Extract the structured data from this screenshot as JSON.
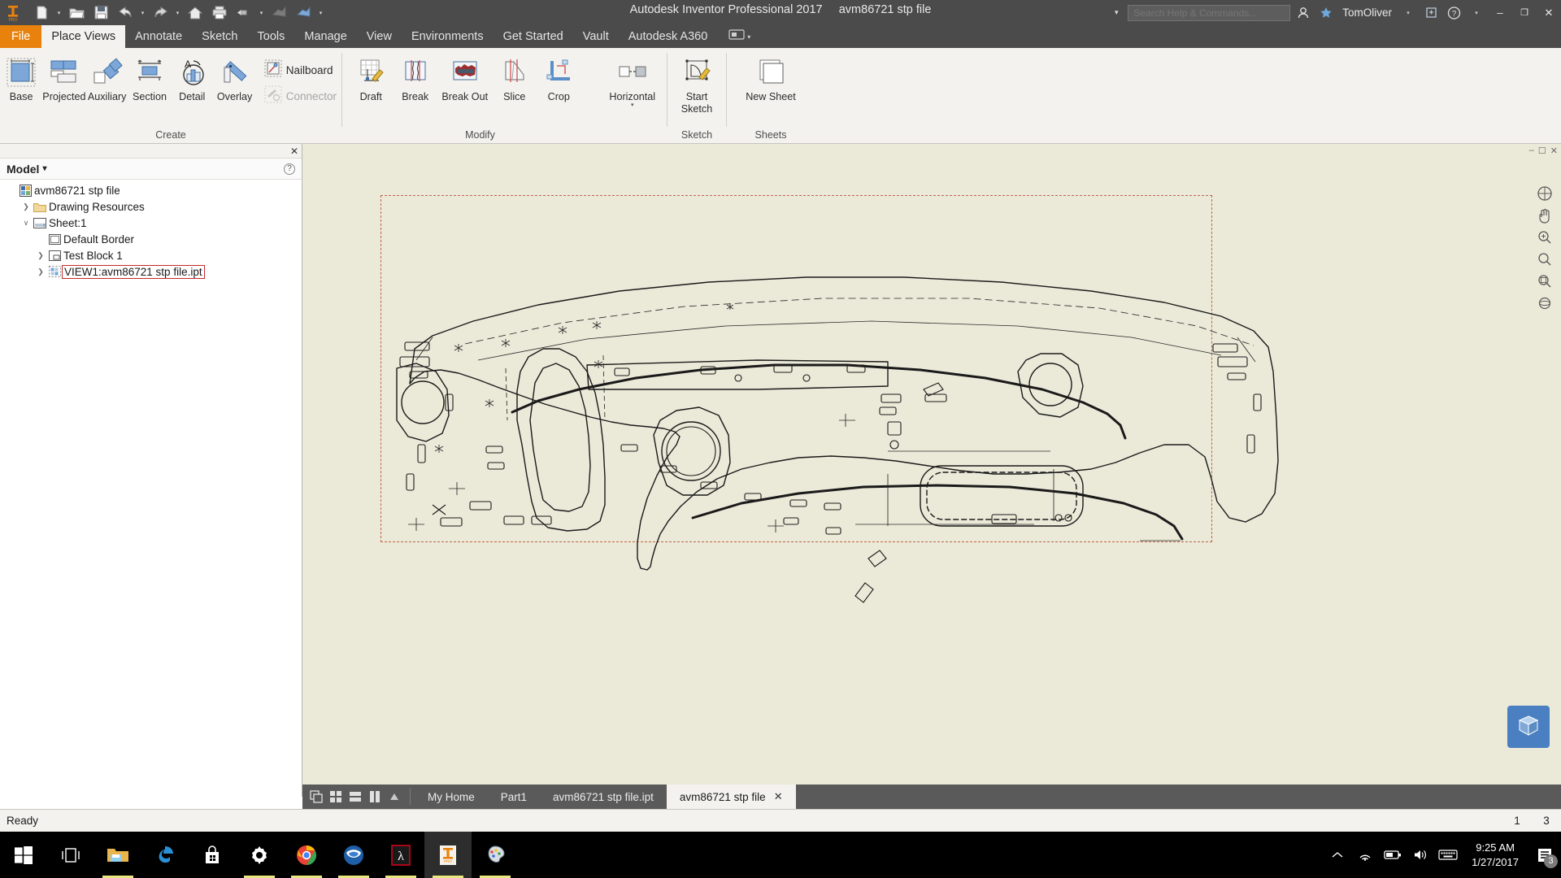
{
  "app": {
    "title": "Autodesk Inventor Professional 2017",
    "document_title": "avm86721 stp file",
    "user": "TomOliver",
    "accent_orange": "#e8820c",
    "titlebar_bg": "#4b4b4b",
    "ribbon_bg": "#f3f2ee",
    "canvas_bg": "#ebe9d8"
  },
  "quick_access": {
    "items": [
      {
        "name": "new-file",
        "icon": "new-document-icon",
        "has_caret": true
      },
      {
        "name": "open-file",
        "icon": "open-folder-icon",
        "has_caret": false
      },
      {
        "name": "save-file",
        "icon": "floppy-save-icon",
        "has_caret": false
      },
      {
        "name": "undo",
        "icon": "undo-arrow-icon",
        "has_caret": true
      },
      {
        "name": "redo",
        "icon": "redo-arrow-icon",
        "has_caret": true
      },
      {
        "name": "home",
        "icon": "home-icon",
        "has_caret": false
      },
      {
        "name": "print",
        "icon": "printer-icon",
        "has_caret": false
      },
      {
        "name": "return",
        "icon": "return-icon",
        "has_caret": true
      },
      {
        "name": "update-1",
        "icon": "update-grey-icon",
        "has_caret": false
      },
      {
        "name": "update-2",
        "icon": "update-blue-icon",
        "has_caret": true
      }
    ]
  },
  "search": {
    "placeholder": "Search Help & Commands..."
  },
  "title_right": {
    "signin_icon": "signin-icon",
    "star_icon": "star-icon",
    "user_caret": "▾",
    "exchange_icon": "autodesk-exchange-icon",
    "help_icon": "help-question-icon",
    "help_caret": "▾",
    "minimize": "–",
    "maximize": "❐",
    "close": "✕"
  },
  "ribbon_tabs": [
    {
      "label": "File",
      "state": "file"
    },
    {
      "label": "Place Views",
      "state": "active"
    },
    {
      "label": "Annotate",
      "state": "normal"
    },
    {
      "label": "Sketch",
      "state": "normal"
    },
    {
      "label": "Tools",
      "state": "normal"
    },
    {
      "label": "Manage",
      "state": "normal"
    },
    {
      "label": "View",
      "state": "normal"
    },
    {
      "label": "Environments",
      "state": "normal"
    },
    {
      "label": "Get Started",
      "state": "normal"
    },
    {
      "label": "Vault",
      "state": "normal"
    },
    {
      "label": "Autodesk A360",
      "state": "normal"
    }
  ],
  "ribbon_panels": [
    {
      "name": "create",
      "label": "Create",
      "big_buttons": [
        {
          "label": "Base",
          "icon": "base-view-icon"
        },
        {
          "label": "Projected",
          "icon": "projected-view-icon"
        },
        {
          "label": "Auxiliary",
          "icon": "auxiliary-view-icon"
        },
        {
          "label": "Section",
          "icon": "section-view-icon"
        },
        {
          "label": "Detail",
          "icon": "detail-view-icon"
        },
        {
          "label": "Overlay",
          "icon": "overlay-view-icon"
        }
      ],
      "small_buttons": [
        {
          "label": "Nailboard",
          "icon": "nailboard-icon",
          "disabled": false
        },
        {
          "label": "Connector",
          "icon": "connector-icon",
          "disabled": true
        }
      ]
    },
    {
      "name": "modify",
      "label": "Modify",
      "big_buttons": [
        {
          "label": "Draft",
          "icon": "draft-icon"
        },
        {
          "label": "Break",
          "icon": "break-icon"
        },
        {
          "label": "Break Out",
          "icon": "break-out-icon"
        },
        {
          "label": "Slice",
          "icon": "slice-icon"
        },
        {
          "label": "Crop",
          "icon": "crop-icon"
        },
        {
          "label": "Horizontal",
          "icon": "horizontal-align-icon",
          "has_caret": true
        }
      ],
      "small_buttons": []
    },
    {
      "name": "sketch",
      "label": "Sketch",
      "big_buttons": [
        {
          "label": "Start Sketch",
          "icon": "start-sketch-icon"
        }
      ],
      "small_buttons": []
    },
    {
      "name": "sheets",
      "label": "Sheets",
      "big_buttons": [
        {
          "label": "New Sheet",
          "icon": "new-sheet-icon"
        }
      ],
      "small_buttons": []
    }
  ],
  "browser": {
    "title": "Model",
    "title_caret": "▾",
    "close_glyph": "✕",
    "help_glyph": "?",
    "tree": [
      {
        "label": "avm86721 stp file",
        "depth": 0,
        "expander": "",
        "icon": "drawing-doc-icon",
        "selected": false
      },
      {
        "label": "Drawing Resources",
        "depth": 1,
        "expander": "❯",
        "icon": "folder-icon",
        "selected": false
      },
      {
        "label": "Sheet:1",
        "depth": 1,
        "expander": "❯",
        "expanded": true,
        "icon": "sheet-icon",
        "selected": false
      },
      {
        "label": "Default Border",
        "depth": 2,
        "expander": "",
        "icon": "border-icon",
        "selected": false
      },
      {
        "label": "Test Block 1",
        "depth": 2,
        "expander": "❯",
        "icon": "title-block-icon",
        "selected": false
      },
      {
        "label": "VIEW1:avm86721 stp file.ipt",
        "depth": 2,
        "expander": "❯",
        "icon": "view-icon",
        "selected": true
      }
    ]
  },
  "canvas": {
    "window_controls": [
      "–",
      "❐",
      "✕"
    ],
    "nav_tools": [
      {
        "name": "full-navigation-wheel",
        "icon": "nav-wheel-icon"
      },
      {
        "name": "pan-tool",
        "icon": "hand-pan-icon"
      },
      {
        "name": "zoom-tool",
        "icon": "magnifier-zoom-icon"
      },
      {
        "name": "zoom-window",
        "icon": "zoom-window-icon"
      },
      {
        "name": "zoom-all",
        "icon": "zoom-all-icon"
      },
      {
        "name": "orbit-tool",
        "icon": "orbit-icon"
      }
    ],
    "viewcube_label": "view-cube"
  },
  "document_tabs": {
    "view_icons": [
      {
        "name": "cascade-windows",
        "icon": "cascade-icon"
      },
      {
        "name": "tile-windows",
        "icon": "tile-grid-icon"
      },
      {
        "name": "tile-horizontal",
        "icon": "tile-horizontal-icon"
      },
      {
        "name": "tile-vertical",
        "icon": "tile-vertical-icon"
      },
      {
        "name": "expand-tabs",
        "icon": "triangle-up-icon"
      }
    ],
    "tabs": [
      {
        "label": "My Home",
        "active": false,
        "closable": false
      },
      {
        "label": "Part1",
        "active": false,
        "closable": false
      },
      {
        "label": "avm86721 stp file.ipt",
        "active": false,
        "closable": false
      },
      {
        "label": "avm86721 stp file",
        "active": true,
        "closable": true,
        "close_glyph": "✕"
      }
    ]
  },
  "status_bar": {
    "message": "Ready",
    "left_number": "1",
    "right_number": "3"
  },
  "taskbar": {
    "items": [
      {
        "name": "start-button",
        "icon": "windows-logo-icon",
        "active": false,
        "running": false
      },
      {
        "name": "task-view",
        "icon": "task-view-icon",
        "active": false,
        "running": false
      },
      {
        "name": "file-explorer",
        "icon": "folder-explorer-icon",
        "active": false,
        "running": true
      },
      {
        "name": "microsoft-edge",
        "icon": "edge-icon",
        "active": false,
        "running": false
      },
      {
        "name": "microsoft-store",
        "icon": "store-bag-icon",
        "active": false,
        "running": false
      },
      {
        "name": "settings",
        "icon": "gear-settings-icon",
        "active": false,
        "running": true
      },
      {
        "name": "google-chrome",
        "icon": "chrome-icon",
        "active": false,
        "running": true
      },
      {
        "name": "thunderbird",
        "icon": "thunderbird-icon",
        "active": false,
        "running": true
      },
      {
        "name": "adobe-acrobat",
        "icon": "acrobat-pdf-icon",
        "active": false,
        "running": true
      },
      {
        "name": "autodesk-inventor",
        "icon": "inventor-icon",
        "active": true,
        "running": true
      },
      {
        "name": "paint",
        "icon": "paint-palette-icon",
        "active": false,
        "running": true
      }
    ],
    "tray": [
      {
        "name": "show-hidden-icons",
        "icon": "chevron-up-icon"
      },
      {
        "name": "network",
        "icon": "wifi-icon"
      },
      {
        "name": "battery",
        "icon": "battery-icon"
      },
      {
        "name": "volume",
        "icon": "speaker-volume-icon"
      },
      {
        "name": "touch-keyboard",
        "icon": "keyboard-icon"
      }
    ],
    "clock_time": "9:25 AM",
    "clock_date": "1/27/2017",
    "notification_count": "3"
  }
}
